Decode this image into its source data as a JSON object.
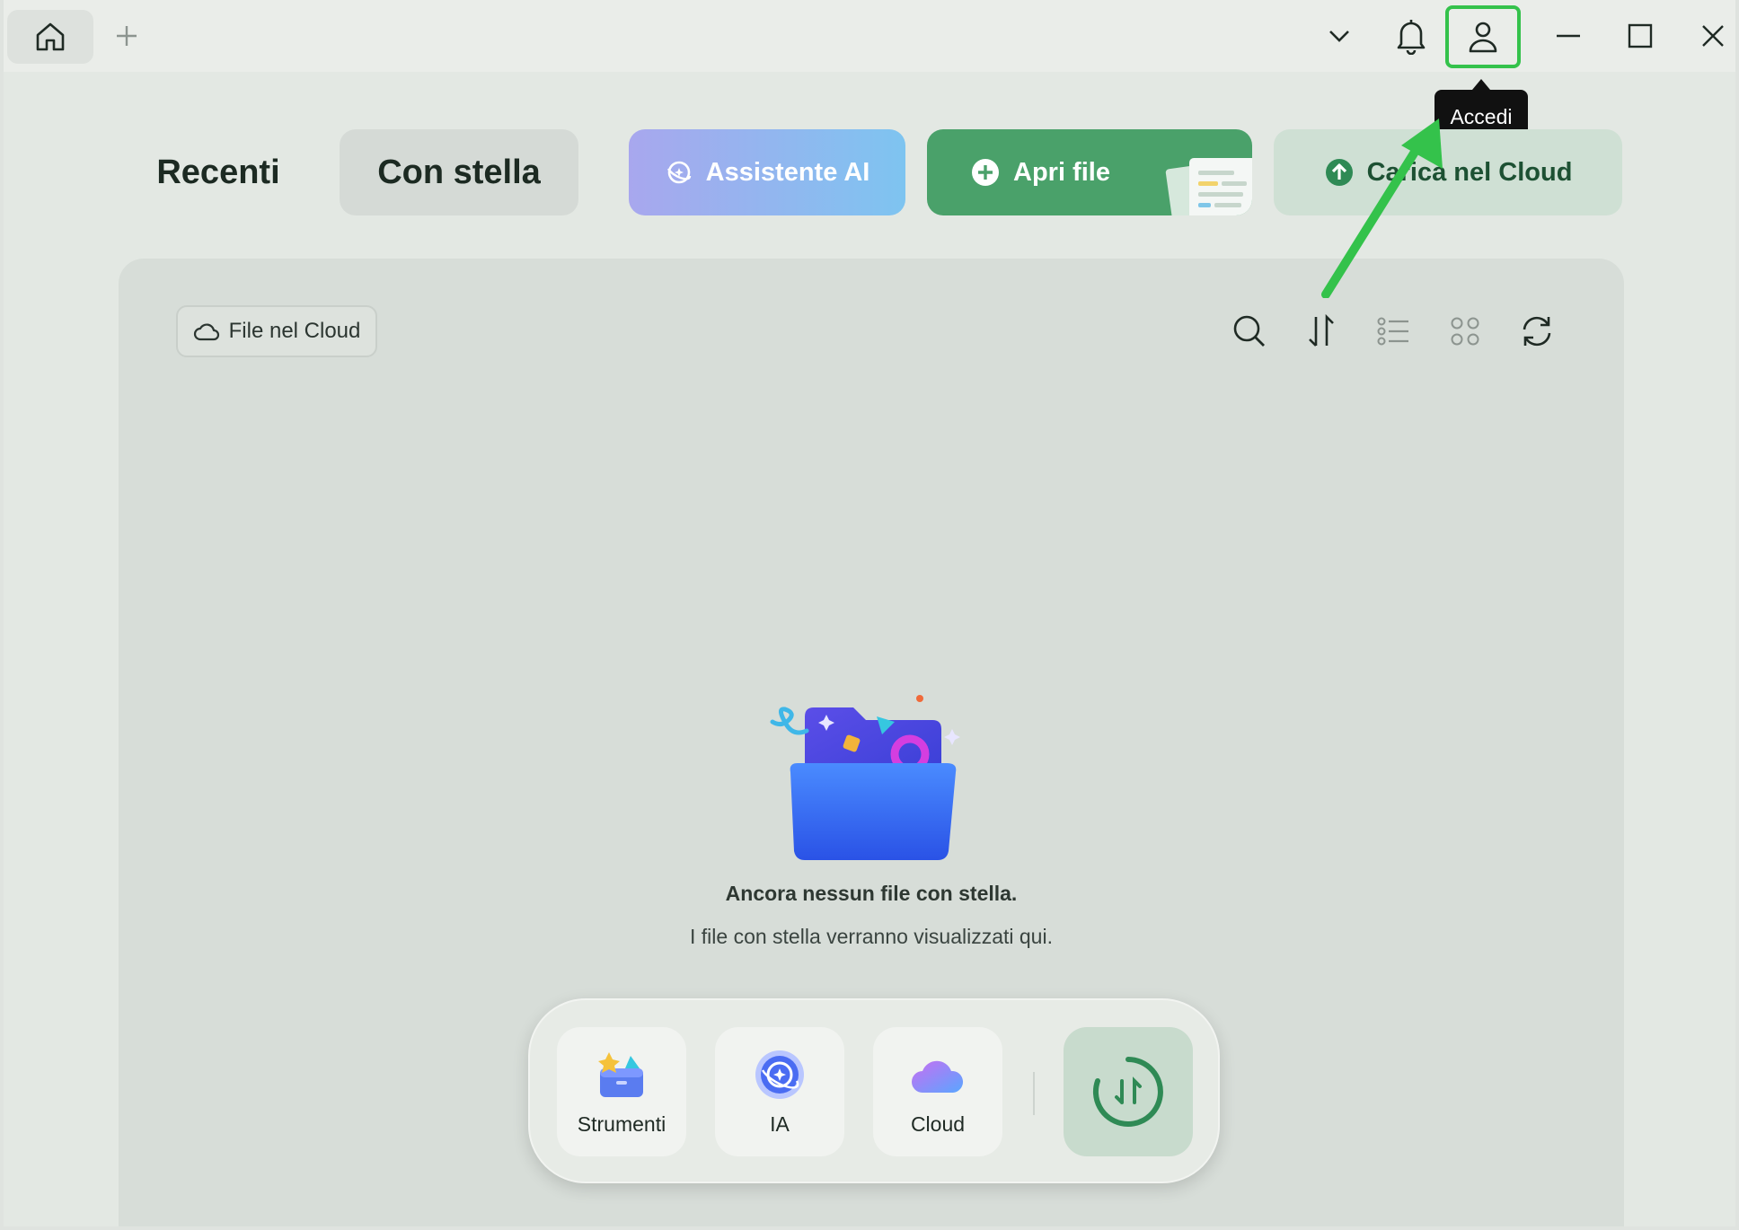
{
  "titlebar": {
    "home_icon": "home-icon",
    "new_tab_icon": "plus-icon",
    "dropdown_icon": "chevron-down-icon",
    "notifications_icon": "bell-icon",
    "account_icon": "user-icon",
    "account_tooltip": "Accedi",
    "minimize_icon": "minimize-icon",
    "maximize_icon": "maximize-icon",
    "close_icon": "close-icon"
  },
  "tabs": [
    {
      "label": "Recenti",
      "active": false
    },
    {
      "label": "Con stella",
      "active": true
    }
  ],
  "actions": {
    "ai_label": "Assistente AI",
    "open_label": "Apri file",
    "cloud_label": "Carica nel Cloud"
  },
  "panel": {
    "cloud_filter_label": "File nel Cloud",
    "toolbar_icons": [
      "search-icon",
      "sort-icon",
      "list-view-icon",
      "grid-view-icon",
      "refresh-icon"
    ],
    "empty_title": "Ancora nessun file con stella.",
    "empty_subtitle": "I file con stella verranno visualizzati qui."
  },
  "dock": {
    "items": [
      {
        "label": "Strumenti",
        "icon": "toolbox-icon"
      },
      {
        "label": "IA",
        "icon": "ai-icon"
      },
      {
        "label": "Cloud",
        "icon": "cloud-icon"
      }
    ],
    "sync_icon": "sync-icon"
  },
  "colors": {
    "highlight": "#34c24b",
    "open_button": "#4aa16a",
    "cloud_button": "#cfe0d4"
  }
}
